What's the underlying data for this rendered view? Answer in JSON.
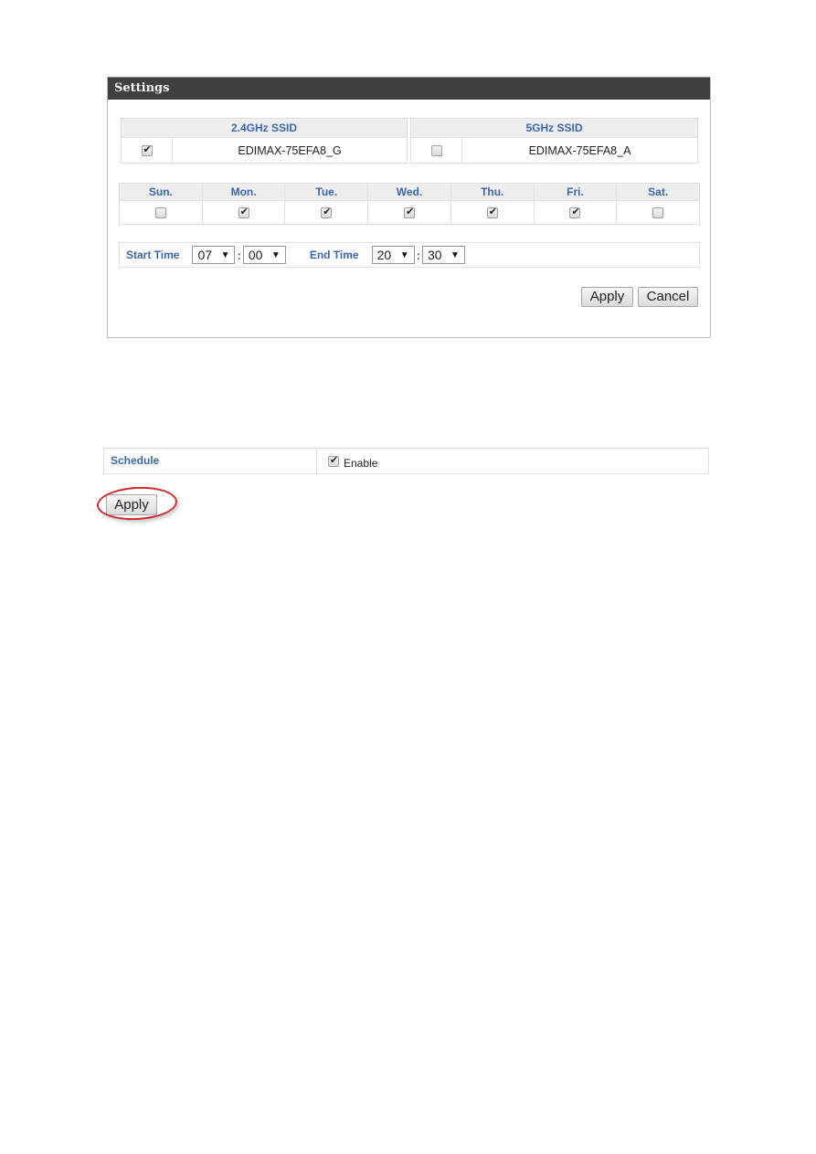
{
  "settings_panel": {
    "title": "Settings",
    "ssids": [
      {
        "band_label": "2.4GHz SSID",
        "name": "EDIMAX-75EFA8_G",
        "checked": true
      },
      {
        "band_label": "5GHz SSID",
        "name": "EDIMAX-75EFA8_A",
        "checked": false
      }
    ],
    "days": [
      {
        "label": "Sun.",
        "checked": false
      },
      {
        "label": "Mon.",
        "checked": true
      },
      {
        "label": "Tue.",
        "checked": true
      },
      {
        "label": "Wed.",
        "checked": true
      },
      {
        "label": "Thu.",
        "checked": true
      },
      {
        "label": "Fri.",
        "checked": true
      },
      {
        "label": "Sat.",
        "checked": false
      }
    ],
    "start_time": {
      "label": "Start Time",
      "hour": "07",
      "minute": "00"
    },
    "end_time": {
      "label": "End Time",
      "hour": "20",
      "minute": "30"
    },
    "time_separator": ":",
    "dropdown_arrow": "▼",
    "apply_label": "Apply",
    "cancel_label": "Cancel"
  },
  "schedule": {
    "label": "Schedule",
    "enable_label": "Enable",
    "enabled": true,
    "apply_label": "Apply"
  },
  "colors": {
    "header_bg": "#404040",
    "label_blue": "#3b67ae",
    "highlight_red": "#d42a2a"
  }
}
